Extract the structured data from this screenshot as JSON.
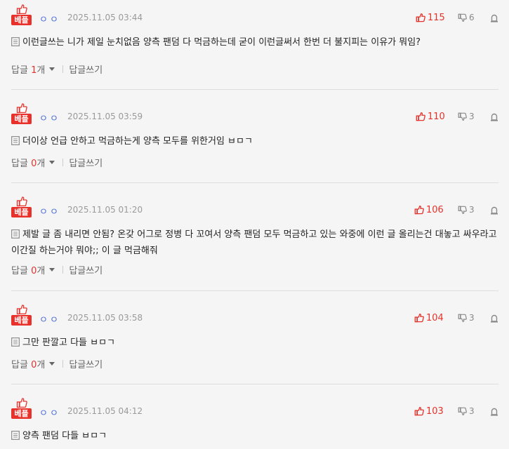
{
  "colors": {
    "accent": "#e8312a",
    "nick": "#4a6cd4",
    "muted": "#9a9a9a",
    "background": "#f5f5f5"
  },
  "icons": {
    "best": "thumbs-up-icon",
    "up": "thumbs-up-icon",
    "down": "thumbs-down-icon",
    "report": "siren-icon",
    "text": "document-icon",
    "caret": "caret-down-icon"
  },
  "comments": [
    {
      "badge": "베플",
      "nick": "ㅇㅇ",
      "time": "2025.11.05 03:44",
      "up": "115",
      "down": "6",
      "text": "이런글쓰는 니가 제일 눈치없음 양측 팬덤 다 먹금하는데 굳이 이런글써서 한번 더 불지피는 이유가 뭐임?",
      "reply_prefix": "답글 ",
      "reply_count": "1",
      "reply_suffix": "개",
      "write_label": "답글쓰기"
    },
    {
      "badge": "베플",
      "nick": "ㅇㅇ",
      "time": "2025.11.05 03:59",
      "up": "110",
      "down": "3",
      "text": "더이상 언급 안하고 먹금하는게 양측 모두를 위한거임 ㅂㅁㄱ",
      "reply_prefix": "답글 ",
      "reply_count": "0",
      "reply_suffix": "개",
      "write_label": "답글쓰기"
    },
    {
      "badge": "베플",
      "nick": "ㅇㅇ",
      "time": "2025.11.05 01:20",
      "up": "106",
      "down": "3",
      "text": "제발 글 좀 내리면 안됨? 온갖 어그로 정병 다 꼬여서 양측 팬덤 모두 먹금하고 있는 와중에 이런 글 올리는건 대놓고 싸우라고 이간질 하는거야 뭐야;; 이 글 먹금해줘",
      "reply_prefix": "답글 ",
      "reply_count": "0",
      "reply_suffix": "개",
      "write_label": "답글쓰기"
    },
    {
      "badge": "베플",
      "nick": "ㅇㅇ",
      "time": "2025.11.05 03:58",
      "up": "104",
      "down": "3",
      "text": "그만 판깔고 다들 ㅂㅁㄱ",
      "reply_prefix": "답글 ",
      "reply_count": "0",
      "reply_suffix": "개",
      "write_label": "답글쓰기"
    },
    {
      "badge": "베플",
      "nick": "ㅇㅇ",
      "time": "2025.11.05 04:12",
      "up": "103",
      "down": "3",
      "text": "양측 팬덤 다들 ㅂㅁㄱ",
      "reply_prefix": "답글 ",
      "reply_count": "0",
      "reply_suffix": "개",
      "write_label": "답글쓰기"
    }
  ]
}
